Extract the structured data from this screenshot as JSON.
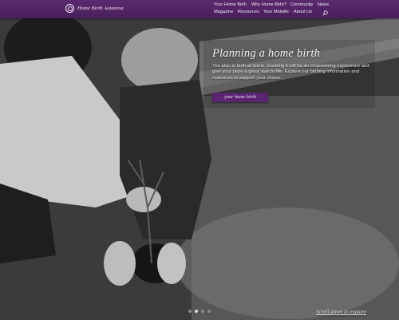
{
  "brand": {
    "name": "Home Birth Aotearoa",
    "logo_icon": "spiral-logo-icon"
  },
  "nav": {
    "row1": [
      "Your Home Birth",
      "Why Home Birth?",
      "Community",
      "News"
    ],
    "row2": [
      "Magazine",
      "Resources",
      "Your Midwife",
      "About Us"
    ],
    "search_icon": "search-icon"
  },
  "hero": {
    "title": "Planning a home birth",
    "body": "You plan to birth at home, knowing it will be an empowering experience and give your pepe a great start to life. Explore our birthing information and resources to support your choice.",
    "cta_label": "your home birth",
    "slides": {
      "count": 4,
      "active": 2
    }
  },
  "footer_hint": "Scroll down to explore",
  "colors": {
    "nav_bg": "#4a1f5c",
    "cta_bg": "#5a2471"
  }
}
